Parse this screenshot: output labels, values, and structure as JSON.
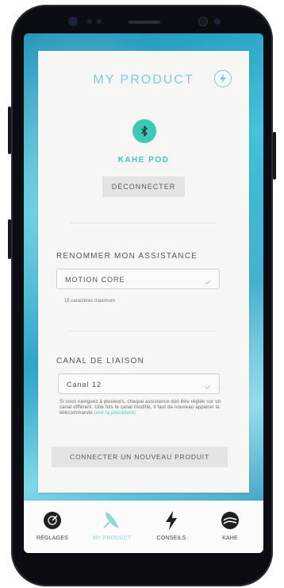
{
  "header": {
    "title": "MY PRODUCT",
    "bolt_icon": "lightning-circle-icon"
  },
  "device": {
    "icon": "bluetooth-icon",
    "name": "KAHE POD",
    "disconnect_label": "DÉCONNECTER"
  },
  "rename": {
    "label": "RENOMMER MON ASSISTANCE",
    "value": "MOTION CORE",
    "hint": "15 caractères maximum"
  },
  "channel": {
    "label": "CANAL DE LIAISON",
    "value": "Canal 12",
    "note": "Si vous naviguez à plusieurs, chaque assistance doit être réglée sur un canal différent. Une fois le canal modifié, il faut de nouveau appairer la télécommande",
    "note_link": "(voir la procédure)"
  },
  "connect_button": "CONNECTER UN NOUVEAU PRODUIT",
  "tabs": [
    {
      "label": "RÉGLAGES",
      "icon": "dial-icon",
      "active": false
    },
    {
      "label": "MY PRODUCT",
      "icon": "board-icon",
      "active": true
    },
    {
      "label": "CONSEILS",
      "icon": "lightning-icon",
      "active": false
    },
    {
      "label": "KAHE",
      "icon": "kahe-logo-icon",
      "active": false
    }
  ],
  "colors": {
    "accent": "#3ec9b6",
    "title": "#7fcbd5",
    "active_tab": "#8fd8d2"
  }
}
